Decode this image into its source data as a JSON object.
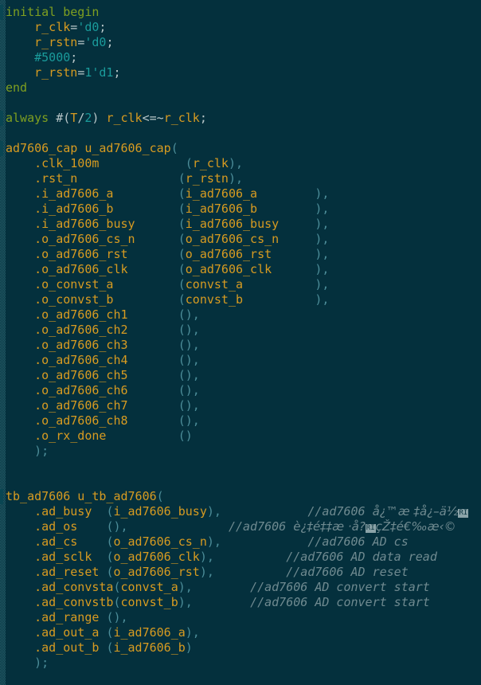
{
  "app": {
    "type": "code-editor",
    "language": "verilog",
    "theme": "dark-teal",
    "colors": {
      "background": "#04303d",
      "keyword": "#7f9f20",
      "identifier": "#d79b21",
      "number": "#1a9b9b",
      "punctuation": "#b9c7c9",
      "paren": "#4c8d99",
      "comment": "#6f8a90",
      "gutter_dither": "#2f6b76"
    }
  },
  "code": {
    "lines": [
      {
        "id": 1,
        "mark": true,
        "tokens": [
          {
            "t": "initial begin",
            "c": "kw"
          }
        ]
      },
      {
        "id": 2,
        "mark": false,
        "tokens": [
          {
            "t": "    ",
            "c": "punct"
          },
          {
            "t": "r_clk",
            "c": "ident"
          },
          {
            "t": "=",
            "c": "punct"
          },
          {
            "t": "'d0",
            "c": "num"
          },
          {
            "t": ";",
            "c": "punct"
          }
        ]
      },
      {
        "id": 3,
        "mark": false,
        "tokens": [
          {
            "t": "    ",
            "c": "punct"
          },
          {
            "t": "r_rstn",
            "c": "ident"
          },
          {
            "t": "=",
            "c": "punct"
          },
          {
            "t": "'d0",
            "c": "num"
          },
          {
            "t": ";",
            "c": "punct"
          }
        ]
      },
      {
        "id": 4,
        "mark": false,
        "tokens": [
          {
            "t": "    ",
            "c": "punct"
          },
          {
            "t": "#5000",
            "c": "num"
          },
          {
            "t": ";",
            "c": "punct"
          }
        ]
      },
      {
        "id": 5,
        "mark": false,
        "tokens": [
          {
            "t": "    ",
            "c": "punct"
          },
          {
            "t": "r_rstn",
            "c": "ident"
          },
          {
            "t": "=",
            "c": "punct"
          },
          {
            "t": "1'd1",
            "c": "num"
          },
          {
            "t": ";",
            "c": "punct"
          }
        ]
      },
      {
        "id": 6,
        "mark": false,
        "tokens": [
          {
            "t": "end",
            "c": "kw"
          }
        ]
      },
      {
        "id": 7,
        "mark": false,
        "tokens": []
      },
      {
        "id": 8,
        "mark": true,
        "tokens": [
          {
            "t": "always ",
            "c": "kw"
          },
          {
            "t": "#(",
            "c": "punct"
          },
          {
            "t": "T",
            "c": "ident"
          },
          {
            "t": "/",
            "c": "punct"
          },
          {
            "t": "2",
            "c": "num"
          },
          {
            "t": ") ",
            "c": "punct"
          },
          {
            "t": "r_clk",
            "c": "ident"
          },
          {
            "t": "<=~",
            "c": "punct"
          },
          {
            "t": "r_clk",
            "c": "ident"
          },
          {
            "t": ";",
            "c": "punct"
          }
        ]
      },
      {
        "id": 9,
        "mark": false,
        "tokens": []
      },
      {
        "id": 10,
        "mark": true,
        "tokens": [
          {
            "t": "ad7606_cap u_ad7606_cap",
            "c": "ident"
          },
          {
            "t": "(",
            "c": "paren"
          }
        ]
      },
      {
        "id": 11,
        "mark": false,
        "tokens": [
          {
            "t": "    .clk_100m            ",
            "c": "ident"
          },
          {
            "t": "(",
            "c": "paren"
          },
          {
            "t": "r_clk",
            "c": "ident"
          },
          {
            "t": "),",
            "c": "paren"
          }
        ]
      },
      {
        "id": 12,
        "mark": false,
        "tokens": [
          {
            "t": "    .rst_n              ",
            "c": "ident"
          },
          {
            "t": "(",
            "c": "paren"
          },
          {
            "t": "r_rstn",
            "c": "ident"
          },
          {
            "t": "),",
            "c": "paren"
          }
        ]
      },
      {
        "id": 13,
        "mark": false,
        "tokens": [
          {
            "t": "    .i_ad7606_a         ",
            "c": "ident"
          },
          {
            "t": "(",
            "c": "paren"
          },
          {
            "t": "i_ad7606_a",
            "c": "ident"
          },
          {
            "t": "        ),",
            "c": "paren"
          }
        ]
      },
      {
        "id": 14,
        "mark": false,
        "tokens": [
          {
            "t": "    .i_ad7606_b         ",
            "c": "ident"
          },
          {
            "t": "(",
            "c": "paren"
          },
          {
            "t": "i_ad7606_b",
            "c": "ident"
          },
          {
            "t": "        ),",
            "c": "paren"
          }
        ]
      },
      {
        "id": 15,
        "mark": false,
        "tokens": [
          {
            "t": "    .i_ad7606_busy      ",
            "c": "ident"
          },
          {
            "t": "(",
            "c": "paren"
          },
          {
            "t": "i_ad7606_busy",
            "c": "ident"
          },
          {
            "t": "     ),",
            "c": "paren"
          }
        ]
      },
      {
        "id": 16,
        "mark": false,
        "tokens": [
          {
            "t": "    .o_ad7606_cs_n      ",
            "c": "ident"
          },
          {
            "t": "(",
            "c": "paren"
          },
          {
            "t": "o_ad7606_cs_n",
            "c": "ident"
          },
          {
            "t": "     ),",
            "c": "paren"
          }
        ]
      },
      {
        "id": 17,
        "mark": false,
        "tokens": [
          {
            "t": "    .o_ad7606_rst       ",
            "c": "ident"
          },
          {
            "t": "(",
            "c": "paren"
          },
          {
            "t": "o_ad7606_rst",
            "c": "ident"
          },
          {
            "t": "      ),",
            "c": "paren"
          }
        ]
      },
      {
        "id": 18,
        "mark": false,
        "tokens": [
          {
            "t": "    .o_ad7606_clk       ",
            "c": "ident"
          },
          {
            "t": "(",
            "c": "paren"
          },
          {
            "t": "o_ad7606_clk",
            "c": "ident"
          },
          {
            "t": "      ),",
            "c": "paren"
          }
        ]
      },
      {
        "id": 19,
        "mark": false,
        "tokens": [
          {
            "t": "    .o_convst_a         ",
            "c": "ident"
          },
          {
            "t": "(",
            "c": "paren"
          },
          {
            "t": "convst_a",
            "c": "ident"
          },
          {
            "t": "          ),",
            "c": "paren"
          }
        ]
      },
      {
        "id": 20,
        "mark": false,
        "tokens": [
          {
            "t": "    .o_convst_b         ",
            "c": "ident"
          },
          {
            "t": "(",
            "c": "paren"
          },
          {
            "t": "convst_b",
            "c": "ident"
          },
          {
            "t": "          ),",
            "c": "paren"
          }
        ]
      },
      {
        "id": 21,
        "mark": false,
        "tokens": [
          {
            "t": "    .o_ad7606_ch1       ",
            "c": "ident"
          },
          {
            "t": "(),",
            "c": "paren"
          }
        ]
      },
      {
        "id": 22,
        "mark": false,
        "tokens": [
          {
            "t": "    .o_ad7606_ch2       ",
            "c": "ident"
          },
          {
            "t": "(),",
            "c": "paren"
          }
        ]
      },
      {
        "id": 23,
        "mark": false,
        "tokens": [
          {
            "t": "    .o_ad7606_ch3       ",
            "c": "ident"
          },
          {
            "t": "(),",
            "c": "paren"
          }
        ]
      },
      {
        "id": 24,
        "mark": false,
        "tokens": [
          {
            "t": "    .o_ad7606_ch4       ",
            "c": "ident"
          },
          {
            "t": "(),",
            "c": "paren"
          }
        ]
      },
      {
        "id": 25,
        "mark": false,
        "tokens": [
          {
            "t": "    .o_ad7606_ch5       ",
            "c": "ident"
          },
          {
            "t": "(),",
            "c": "paren"
          }
        ]
      },
      {
        "id": 26,
        "mark": false,
        "tokens": [
          {
            "t": "    .o_ad7606_ch6       ",
            "c": "ident"
          },
          {
            "t": "(),",
            "c": "paren"
          }
        ]
      },
      {
        "id": 27,
        "mark": false,
        "tokens": [
          {
            "t": "    .o_ad7606_ch7       ",
            "c": "ident"
          },
          {
            "t": "(),",
            "c": "paren"
          }
        ]
      },
      {
        "id": 28,
        "mark": false,
        "tokens": [
          {
            "t": "    .o_ad7606_ch8       ",
            "c": "ident"
          },
          {
            "t": "(),",
            "c": "paren"
          }
        ]
      },
      {
        "id": 29,
        "mark": false,
        "tokens": [
          {
            "t": "    .o_rx_done          ",
            "c": "ident"
          },
          {
            "t": "()",
            "c": "paren"
          }
        ]
      },
      {
        "id": 30,
        "mark": false,
        "tokens": [
          {
            "t": "    );",
            "c": "paren"
          }
        ]
      },
      {
        "id": 31,
        "mark": false,
        "tokens": []
      },
      {
        "id": 32,
        "mark": false,
        "tokens": []
      },
      {
        "id": 33,
        "mark": true,
        "tokens": [
          {
            "t": "tb_ad7606 u_tb_ad7606",
            "c": "ident"
          },
          {
            "t": "(",
            "c": "paren"
          }
        ]
      },
      {
        "id": 34,
        "mark": false,
        "tokens": [
          {
            "t": "    .ad_busy  ",
            "c": "ident"
          },
          {
            "t": "(",
            "c": "paren"
          },
          {
            "t": "i_ad7606_busy",
            "c": "ident"
          },
          {
            "t": "),",
            "c": "paren"
          },
          {
            "t": "            ",
            "c": "punct"
          },
          {
            "t": "//ad7606 ",
            "c": "comment"
          },
          {
            "t": "å¿™æ ‡å¿–ä½",
            "c": "mojibake"
          },
          {
            "t": "RI",
            "c": "box"
          }
        ]
      },
      {
        "id": 35,
        "mark": false,
        "tokens": [
          {
            "t": "    .ad_os    ",
            "c": "ident"
          },
          {
            "t": "(),",
            "c": "paren"
          },
          {
            "t": "              ",
            "c": "punct"
          },
          {
            "t": "//ad7606 ",
            "c": "comment"
          },
          {
            "t": "è¿‡é‡‡æ ·å?",
            "c": "mojibake"
          },
          {
            "t": "RI",
            "c": "box"
          },
          {
            "t": "çŽ‡é€‰æ‹©",
            "c": "mojibake"
          }
        ]
      },
      {
        "id": 36,
        "mark": false,
        "tokens": [
          {
            "t": "    .ad_cs    ",
            "c": "ident"
          },
          {
            "t": "(",
            "c": "paren"
          },
          {
            "t": "o_ad7606_cs_n",
            "c": "ident"
          },
          {
            "t": "),",
            "c": "paren"
          },
          {
            "t": "            ",
            "c": "punct"
          },
          {
            "t": "//ad7606 AD cs",
            "c": "comment"
          }
        ]
      },
      {
        "id": 37,
        "mark": false,
        "tokens": [
          {
            "t": "    .ad_sclk  ",
            "c": "ident"
          },
          {
            "t": "(",
            "c": "paren"
          },
          {
            "t": "o_ad7606_clk",
            "c": "ident"
          },
          {
            "t": "),",
            "c": "paren"
          },
          {
            "t": "          ",
            "c": "punct"
          },
          {
            "t": "//ad7606 AD data read",
            "c": "comment"
          }
        ]
      },
      {
        "id": 38,
        "mark": false,
        "tokens": [
          {
            "t": "    .ad_reset ",
            "c": "ident"
          },
          {
            "t": "(",
            "c": "paren"
          },
          {
            "t": "o_ad7606_rst",
            "c": "ident"
          },
          {
            "t": "),",
            "c": "paren"
          },
          {
            "t": "          ",
            "c": "punct"
          },
          {
            "t": "//ad7606 AD reset",
            "c": "comment"
          }
        ]
      },
      {
        "id": 39,
        "mark": false,
        "tokens": [
          {
            "t": "    .ad_convsta",
            "c": "ident"
          },
          {
            "t": "(",
            "c": "paren"
          },
          {
            "t": "convst_a",
            "c": "ident"
          },
          {
            "t": "),",
            "c": "paren"
          },
          {
            "t": "        ",
            "c": "punct"
          },
          {
            "t": "//ad7606 AD convert start",
            "c": "comment"
          }
        ]
      },
      {
        "id": 40,
        "mark": false,
        "tokens": [
          {
            "t": "    .ad_convstb",
            "c": "ident"
          },
          {
            "t": "(",
            "c": "paren"
          },
          {
            "t": "convst_b",
            "c": "ident"
          },
          {
            "t": "),",
            "c": "paren"
          },
          {
            "t": "        ",
            "c": "punct"
          },
          {
            "t": "//ad7606 AD convert start",
            "c": "comment"
          }
        ]
      },
      {
        "id": 41,
        "mark": false,
        "tokens": [
          {
            "t": "    .ad_range ",
            "c": "ident"
          },
          {
            "t": "(),",
            "c": "paren"
          }
        ]
      },
      {
        "id": 42,
        "mark": false,
        "tokens": [
          {
            "t": "    .ad_out_a ",
            "c": "ident"
          },
          {
            "t": "(",
            "c": "paren"
          },
          {
            "t": "i_ad7606_a",
            "c": "ident"
          },
          {
            "t": "),",
            "c": "paren"
          }
        ]
      },
      {
        "id": 43,
        "mark": false,
        "tokens": [
          {
            "t": "    .ad_out_b ",
            "c": "ident"
          },
          {
            "t": "(",
            "c": "paren"
          },
          {
            "t": "i_ad7606_b",
            "c": "ident"
          },
          {
            "t": ")",
            "c": "paren"
          }
        ]
      },
      {
        "id": 44,
        "mark": false,
        "tokens": [
          {
            "t": "    );",
            "c": "paren"
          }
        ]
      }
    ]
  }
}
